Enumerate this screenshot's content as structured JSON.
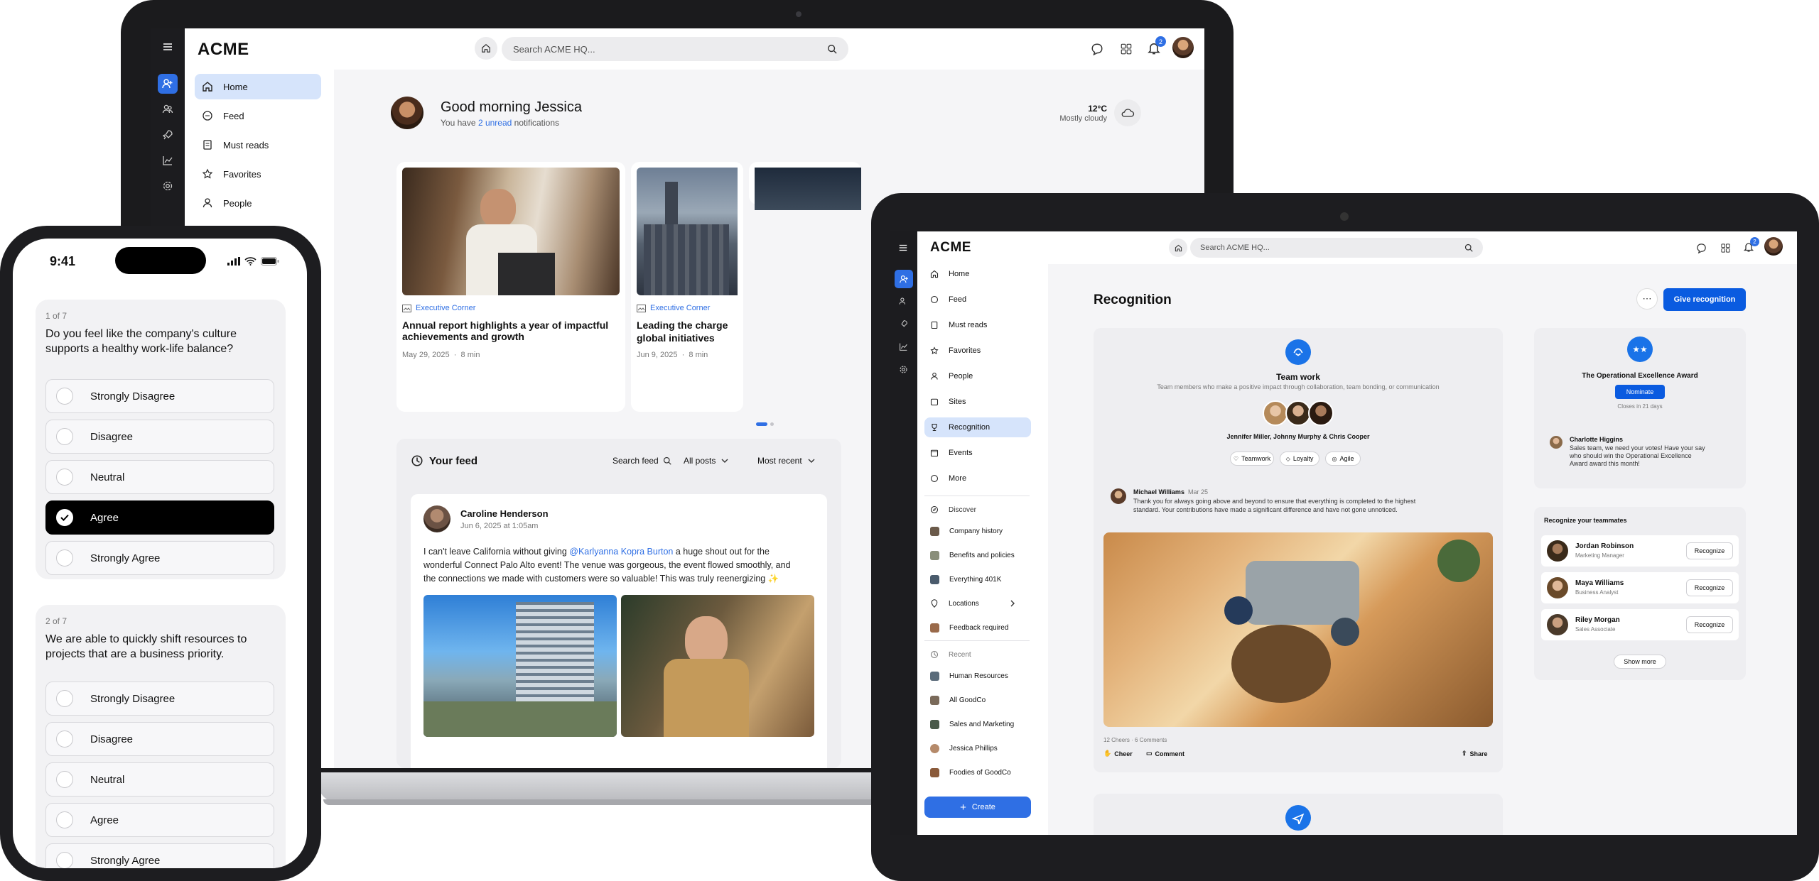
{
  "laptop": {
    "logo": "ACME",
    "search_placeholder": "Search ACME HQ...",
    "notification_count": "2",
    "nav": [
      "Home",
      "Feed",
      "Must reads",
      "Favorites",
      "People"
    ],
    "greeting": "Good morning Jessica",
    "notif_prefix": "You have ",
    "notif_link": "2 unread",
    "notif_suffix": " notifications",
    "weather_temp": "12°C",
    "weather_desc": "Mostly cloudy",
    "news": [
      {
        "tag": "Executive Corner",
        "title": "Annual report highlights a year of impactful achievements and growth",
        "date": "May 29, 2025",
        "read": "8 min"
      },
      {
        "tag": "Executive Corner",
        "title": "Leading the charge",
        "title2": "global initiatives",
        "date": "Jun 9, 2025",
        "read": "8 min"
      }
    ],
    "feed": {
      "title": "Your feed",
      "search": "Search feed",
      "filter": "All posts",
      "sort": "Most recent",
      "post_author": "Caroline Henderson",
      "post_time": "Jun 6, 2025 at 1:05am",
      "post_text_1": "I can't leave California without giving ",
      "post_mention": "@Karlyanna Kopra Burton",
      "post_text_2": " a huge shout out for the",
      "post_text_3": "wonderful Connect Palo Alto event! The venue was gorgeous, the event flowed smoothly, and",
      "post_text_4": "the connections we made with customers were so valuable! This was truly reenergizing ✨"
    }
  },
  "tablet": {
    "logo": "ACME",
    "search_placeholder": "Search ACME HQ...",
    "notification_count": "2",
    "nav": [
      "Home",
      "Feed",
      "Must reads",
      "Favorites",
      "People",
      "Sites",
      "Recognition",
      "Events",
      "More"
    ],
    "discover_label": "Discover",
    "discover": [
      "Company history",
      "Benefits and policies",
      "Everything 401K",
      "Locations",
      "Feedback required"
    ],
    "recent_label": "Recent",
    "recent": [
      "Human Resources",
      "All GoodCo",
      "Sales and Marketing",
      "Jessica Phillips",
      "Foodies of GoodCo"
    ],
    "create": "Create",
    "page_title": "Recognition",
    "give_button": "Give recognition",
    "award": {
      "title": "Team work",
      "desc": "Team members who make a positive impact through collaboration, team bonding, or communication",
      "names": "Jennifer Miller, Johnny Murphy & Chris Cooper",
      "tags": [
        "Teamwork",
        "Loyalty",
        "Agile"
      ],
      "author": "Michael Williams",
      "date": "Mar 25",
      "text_1": "Thank you for always going above and beyond to ensure that everything is completed to the highest",
      "text_2": "standard. Your contributions have made a significant difference and have not gone unnoticed.",
      "stats": "12 Cheers  ·  6 Comments",
      "cheer": "Cheer",
      "comment": "Comment",
      "share": "Share"
    },
    "excellence": {
      "title": "The Operational Excellence Award",
      "button": "Nominate",
      "closes": "Closes in 21 days",
      "author": "Charlotte Higgins",
      "text_1": "Sales team, we need your votes! Have your say",
      "text_2": "who should win the Operational Excellence",
      "text_3": "Award award this month!"
    },
    "teammates": {
      "title": "Recognize your teammates",
      "people": [
        {
          "name": "Jordan Robinson",
          "role": "Marketing Manager"
        },
        {
          "name": "Maya Williams",
          "role": "Business Analyst"
        },
        {
          "name": "Riley Morgan",
          "role": "Sales Associate"
        }
      ],
      "button": "Recognize",
      "show_more": "Show more"
    }
  },
  "phone": {
    "time": "9:41",
    "questions": [
      {
        "counter": "1 of 7",
        "text_1": "Do you feel like the company's culture",
        "text_2": "supports a healthy work-life balance?",
        "options": [
          "Strongly Disagree",
          "Disagree",
          "Neutral",
          "Agree",
          "Strongly Agree"
        ],
        "selected": "Agree"
      },
      {
        "counter": "2 of 7",
        "text_1": "We are able to quickly shift resources to",
        "text_2": "projects that are a business priority.",
        "options": [
          "Strongly Disagree",
          "Disagree",
          "Neutral",
          "Agree",
          "Strongly Agree"
        ],
        "selected": ""
      }
    ]
  },
  "colors": {
    "accent": "#2f6fe4",
    "selected": "#000000",
    "rail": "#1c1c1f"
  }
}
